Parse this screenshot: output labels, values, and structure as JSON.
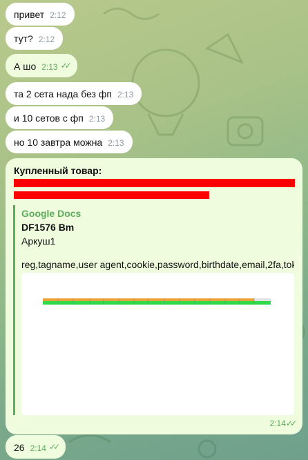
{
  "messages": [
    {
      "text": "привет",
      "time": "2:12"
    },
    {
      "text": "тут?",
      "time": "2:12"
    },
    {
      "text": "А шо",
      "time": "2:13",
      "outgoing": true,
      "ticks": "✓✓"
    },
    {
      "text": "та 2 сета нада без фп",
      "time": "2:13"
    },
    {
      "text": "и 10 сетов с фп",
      "time": "2:13"
    },
    {
      "text": "но 10 завтра можна",
      "time": "2:13"
    }
  ],
  "card": {
    "title": "Купленный товар:",
    "preview": {
      "site": "Google Docs",
      "title": "DF1576 Bm",
      "subtitle": "Аркуш1",
      "description": "reg,tagname,user agent,cookie,password,birthdate,email,2fa,tok..."
    },
    "time": "2:14",
    "ticks": "✓✓"
  },
  "last_message": {
    "text": "26",
    "time": "2:14",
    "ticks": "✓✓"
  },
  "colors": {
    "outgoing_bg": "#effdde",
    "incoming_bg": "#ffffff",
    "accent_green": "#5dac5b",
    "redaction": "#ff0000"
  }
}
